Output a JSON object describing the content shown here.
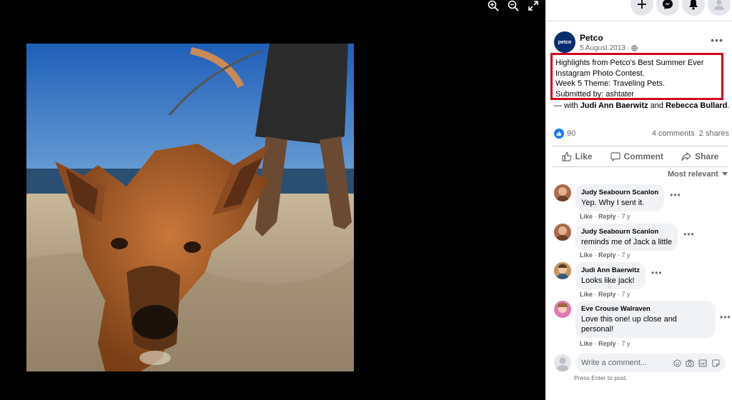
{
  "viewer": {
    "tools": [
      "zoom-in-icon",
      "zoom-out-icon",
      "fullscreen-icon"
    ]
  },
  "topbar": {
    "buttons": [
      "plus-icon",
      "messenger-icon",
      "bell-icon",
      "account-icon"
    ]
  },
  "post": {
    "page_name": "Petco",
    "logo_text": "petco",
    "date": "5 August 2013 ·",
    "caption_lines": [
      "Highlights from Petco's Best Summer Ever",
      "Instagram Photo Contest.",
      "Week 5 Theme: Traveling Pets.",
      "Submitted by: ashtater"
    ],
    "tagged_prefix": "— with",
    "tagged_person_1": "Judi Ann Baerwitz",
    "tagged_joiner": "and",
    "tagged_person_2": "Rebecca Bullard",
    "tagged_suffix": "."
  },
  "stats": {
    "likes": "90",
    "comments": "4 comments",
    "shares": "2 shares"
  },
  "actions": {
    "like": "Like",
    "comment": "Comment",
    "share": "Share"
  },
  "sort_label": "Most relevant",
  "comments": [
    {
      "author": "Judy Seabourn Scanlon",
      "text": "Yep. Why I sent it.",
      "like": "Like",
      "reply": "Reply",
      "age": "7 y"
    },
    {
      "author": "Judy Seabourn Scanlon",
      "text": "reminds me of Jack a little",
      "like": "Like",
      "reply": "Reply",
      "age": "7 y"
    },
    {
      "author": "Judi Ann Baerwitz",
      "text": "Looks like jack!",
      "like": "Like",
      "reply": "Reply",
      "age": "7 y"
    },
    {
      "author": "Eve Crouse Walraven",
      "text_line1": "Love this one! up close and",
      "text_line2": "personal!",
      "like": "Like",
      "reply": "Reply",
      "age": "7 y"
    }
  ],
  "composer": {
    "placeholder": "Write a comment...",
    "hint": "Press Enter to post."
  },
  "colors": {
    "accent": "#1877f2",
    "highlight_box": "#d0021b"
  }
}
